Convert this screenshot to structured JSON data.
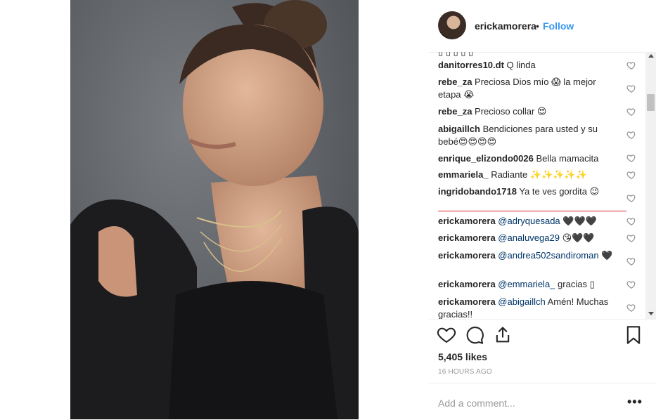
{
  "post": {
    "username": "erickamorera",
    "separator": "•",
    "follow_label": "Follow"
  },
  "comments": [
    {
      "user": "danitorres10.dt",
      "text": "Q linda"
    },
    {
      "user": "rebe_za",
      "text": "Preciosa Dios mío 😱 la mejor etapa 😭"
    },
    {
      "user": "rebe_za",
      "text": "Precioso collar 😍"
    },
    {
      "user": "abigaillch",
      "text": "Bendiciones para usted y su bebé😍😍😍😍"
    },
    {
      "user": "enrique_elizondo0026",
      "text": "Bella mamacita"
    },
    {
      "user": "emmariela_",
      "text": "Radiante ✨✨✨✨✨"
    },
    {
      "user": "ingridobando1718",
      "text": "Ya te ves gordita 😉"
    },
    {
      "user": "erickamorera",
      "mention": "@adryquesada",
      "text": "🖤🖤🖤"
    },
    {
      "user": "erickamorera",
      "mention": "@analuvega29",
      "text": "😘🖤🖤"
    },
    {
      "user": "erickamorera",
      "mention": "@andrea502sandiroman",
      "text": "🖤"
    },
    {
      "user": "erickamorera",
      "mention": "@emmariela_",
      "text": "gracias ▯"
    },
    {
      "user": "erickamorera",
      "mention": "@abigaillch",
      "text": "Amén! Muchas gracias!!"
    }
  ],
  "likes": "5,405 likes",
  "timestamp": "16 HOURS AGO",
  "add_comment": {
    "placeholder": "Add a comment..."
  },
  "more_label": "•••",
  "colors": {
    "link": "#3897f0",
    "mention": "#003569",
    "text": "#262626",
    "muted": "#999999",
    "divider_line": "#e0242c"
  },
  "icons": {
    "like": "heart-outline-icon",
    "comment": "speech-bubble-icon",
    "share": "share-upload-icon",
    "save": "bookmark-icon",
    "comment_like": "small-heart-icon"
  }
}
